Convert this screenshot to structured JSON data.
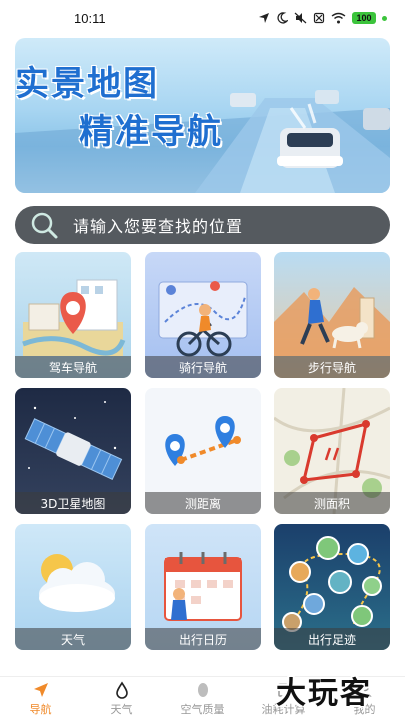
{
  "status_bar": {
    "time": "10:11",
    "battery": "100",
    "icons": [
      "location-arrow-icon",
      "moon-icon",
      "mute-icon",
      "sim-off-icon",
      "wifi-icon",
      "battery-icon"
    ]
  },
  "banner": {
    "line1": "实景地图",
    "line2": "精准导航"
  },
  "search": {
    "placeholder": "请输入您要查找的位置"
  },
  "features": [
    {
      "label": "驾车导航"
    },
    {
      "label": "骑行导航"
    },
    {
      "label": "步行导航"
    },
    {
      "label": "3D卫星地图"
    },
    {
      "label": "测距离"
    },
    {
      "label": "测面积"
    },
    {
      "label": "天气"
    },
    {
      "label": "出行日历"
    },
    {
      "label": "出行足迹"
    }
  ],
  "bottom_nav": [
    {
      "label": "导航",
      "icon": "navigation-arrow-icon",
      "active": true
    },
    {
      "label": "天气",
      "icon": "drop-icon",
      "active": false
    },
    {
      "label": "空气质量",
      "icon": "leaf-icon",
      "active": false
    },
    {
      "label": "油耗计算",
      "icon": "fuel-icon",
      "active": false
    },
    {
      "label": "我的",
      "icon": "user-icon",
      "active": false
    }
  ],
  "watermark": "大玩客",
  "colors": {
    "accent": "#f08a2a",
    "search_bg": "#555a5f",
    "banner_text": "#1f6fd0"
  }
}
